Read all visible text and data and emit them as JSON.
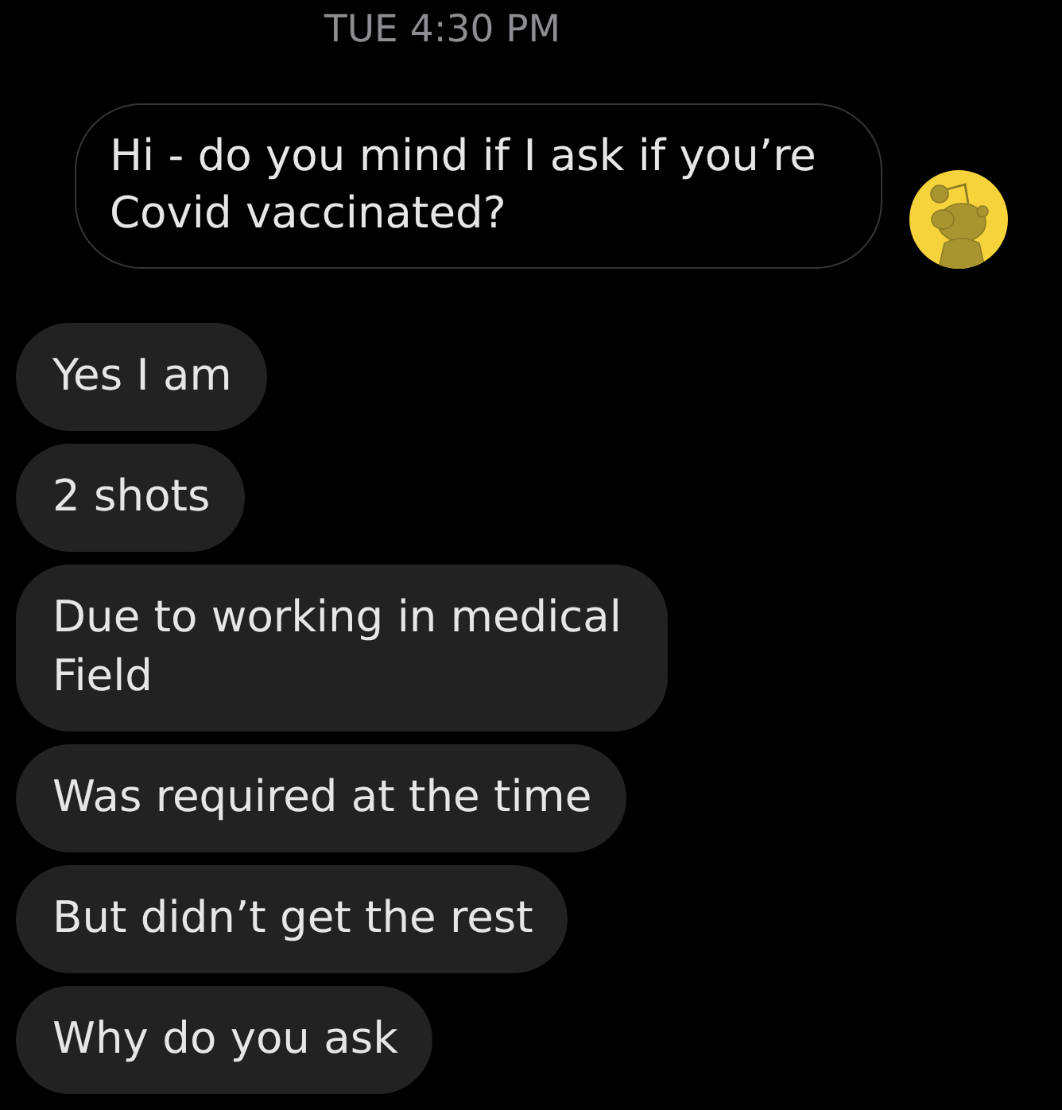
{
  "timestamp": "TUE 4:30 PM",
  "messages": [
    {
      "kind": "sent",
      "text": "Hi - do you mind if I ask if you’re Covid vaccinated?"
    },
    {
      "kind": "received",
      "text": "Yes I am"
    },
    {
      "kind": "received",
      "text": "2 shots"
    },
    {
      "kind": "received",
      "text": "Due to working in medical Field"
    },
    {
      "kind": "received",
      "text": "Was required at the time"
    },
    {
      "kind": "received",
      "text": "But didn’t get the rest"
    },
    {
      "kind": "received",
      "text": "Why do you ask"
    }
  ]
}
